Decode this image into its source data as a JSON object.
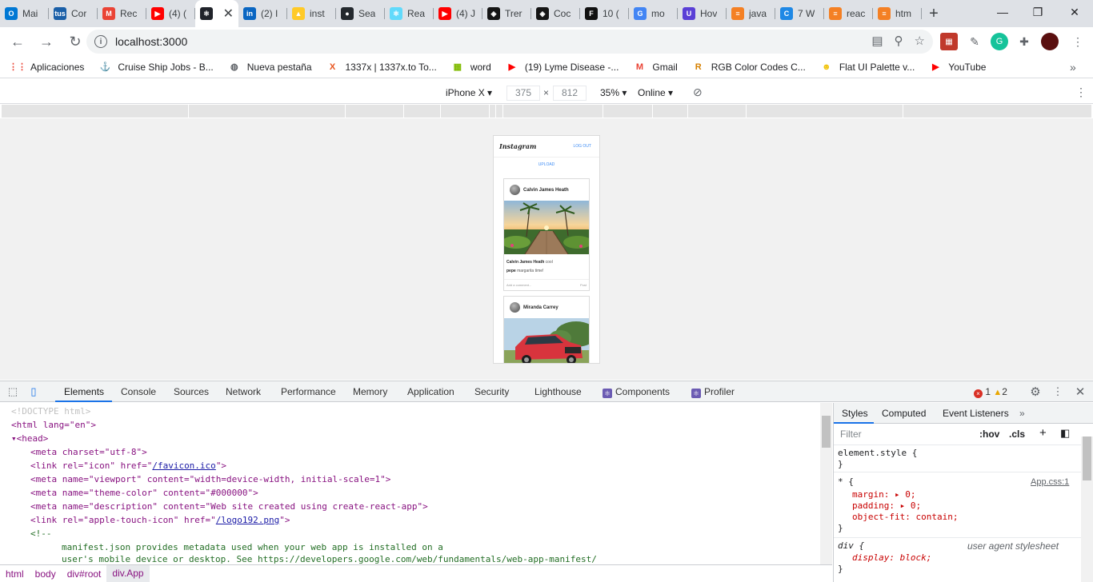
{
  "browser": {
    "tabs": [
      {
        "label": "Mai",
        "icon": "outlook-icon",
        "color": "#0078d4",
        "glyph": "O"
      },
      {
        "label": "Cor",
        "icon": "tus-icon",
        "color": "#1a5fa8",
        "glyph": "tus"
      },
      {
        "label": "Rec",
        "icon": "gmail-icon",
        "color": "#ea4335",
        "glyph": "M"
      },
      {
        "label": "(4) (",
        "icon": "youtube-icon",
        "color": "#ff0000",
        "glyph": "▶"
      },
      {
        "label": "",
        "icon": "react-icon",
        "color": "#20232a",
        "glyph": "⚛",
        "active": true
      },
      {
        "label": "(2) I",
        "icon": "linkedin-icon",
        "color": "#0a66c2",
        "glyph": "in"
      },
      {
        "label": "inst",
        "icon": "firebase-icon",
        "color": "#ffca28",
        "glyph": "▲"
      },
      {
        "label": "Sea",
        "icon": "github-icon",
        "color": "#24292e",
        "glyph": "●"
      },
      {
        "label": "Rea",
        "icon": "react-icon",
        "color": "#61dafb",
        "glyph": "⚛"
      },
      {
        "label": "(4) J",
        "icon": "youtube-icon",
        "color": "#ff0000",
        "glyph": "▶"
      },
      {
        "label": "Trer",
        "icon": "codesandbox-icon",
        "color": "#151515",
        "glyph": "◈"
      },
      {
        "label": "Coc",
        "icon": "codesandbox-icon",
        "color": "#151515",
        "glyph": "◈"
      },
      {
        "label": "10 (",
        "icon": "f-icon",
        "color": "#111111",
        "glyph": "F"
      },
      {
        "label": "mo",
        "icon": "google-icon",
        "color": "#4285f4",
        "glyph": "G"
      },
      {
        "label": "Hov",
        "icon": "u-icon",
        "color": "#5a3fd6",
        "glyph": "U"
      },
      {
        "label": "java",
        "icon": "stackoverflow-icon",
        "color": "#f48024",
        "glyph": "≡"
      },
      {
        "label": "7 W",
        "icon": "c-icon",
        "color": "#1e88e5",
        "glyph": "C"
      },
      {
        "label": "reac",
        "icon": "stackoverflow-icon",
        "color": "#f48024",
        "glyph": "≡"
      },
      {
        "label": "htm",
        "icon": "stackoverflow-icon",
        "color": "#f48024",
        "glyph": "≡"
      }
    ],
    "url": "localhost:3000",
    "bookmarks": [
      {
        "label": "Aplicaciones",
        "icon": "apps-grid-icon",
        "glyph": "⋮⋮",
        "color": "#ea4335"
      },
      {
        "label": "Cruise Ship Jobs - B...",
        "icon": "anchor-icon",
        "glyph": "⚓",
        "color": "#f5a623"
      },
      {
        "label": "Nueva pestaña",
        "icon": "globe-icon",
        "glyph": "◍",
        "color": "#5f6368"
      },
      {
        "label": "1337x | 1337x.to To...",
        "icon": "x-icon",
        "glyph": "X",
        "color": "#e8541e"
      },
      {
        "label": "word",
        "icon": "microsoft-icon",
        "glyph": "▦",
        "color": "#7fba00"
      },
      {
        "label": "(19) Lyme Disease -...",
        "icon": "youtube-icon",
        "glyph": "▶",
        "color": "#ff0000"
      },
      {
        "label": "Gmail",
        "icon": "gmail-icon",
        "glyph": "M",
        "color": "#ea4335"
      },
      {
        "label": "RGB Color Codes C...",
        "icon": "r-icon",
        "glyph": "R",
        "color": "#d68000"
      },
      {
        "label": "Flat UI Palette v...",
        "icon": "emoji-icon",
        "glyph": "☻",
        "color": "#f1c40f"
      },
      {
        "label": "YouTube",
        "icon": "youtube-icon",
        "glyph": "▶",
        "color": "#ff0000"
      }
    ]
  },
  "device_toolbar": {
    "device": "iPhone X",
    "width": "375",
    "height": "812",
    "zoom": "35%",
    "throttle": "Online"
  },
  "instagram": {
    "logo": "Instagram",
    "logout": "LOG OUT",
    "upload": "UPLOAD",
    "posts": [
      {
        "username": "Calvin James Heath",
        "caption_user": "Calvin James Heath",
        "caption": "cool",
        "comments": [
          {
            "user": "pepe",
            "text": "margarita time!"
          }
        ],
        "add_comment_placeholder": "Add a comment...",
        "post_button": "Post"
      },
      {
        "username": "Miranda Carrey"
      }
    ]
  },
  "devtools": {
    "tabs": [
      "Elements",
      "Console",
      "Sources",
      "Network",
      "Performance",
      "Memory",
      "Application",
      "Security",
      "Lighthouse",
      "Components",
      "Profiler"
    ],
    "error_count": "1",
    "warning_count": "2",
    "breadcrumb": [
      "html",
      "body",
      "div#root",
      "div.App"
    ],
    "styles_tabs": [
      "Styles",
      "Computed",
      "Event Listeners"
    ],
    "filter_placeholder": "Filter",
    "hov": ":hov",
    "cls": ".cls",
    "element_style": "element.style {",
    "rule1_selector": "* {",
    "rule1_source": "App.css:1",
    "rule1_props": [
      "margin: ▸ 0;",
      "padding: ▸ 0;",
      "object-fit: contain;"
    ],
    "rule2_selector": "div {",
    "rule2_source": "user agent stylesheet",
    "rule2_props": [
      "display: block;"
    ],
    "close_brace": "}",
    "html_lines": {
      "doctype": "<!DOCTYPE html>",
      "html_open": "<html lang=\"en\">",
      "head_open": "<head>",
      "meta_charset": "<meta charset=\"utf-8\">",
      "link_icon_pre": "<link rel=\"icon\" href=\"",
      "link_icon_href": "/favicon.ico",
      "link_icon_post": "\">",
      "meta_viewport": "<meta name=\"viewport\" content=\"width=device-width, initial-scale=1\">",
      "meta_theme": "<meta name=\"theme-color\" content=\"#000000\">",
      "meta_description": "<meta name=\"description\" content=\"Web site created using create-react-app\">",
      "link_apple_pre": "<link rel=\"apple-touch-icon\" href=\"",
      "link_apple_href": "/logo192.png",
      "link_apple_post": "\">",
      "comment_open": "<!--",
      "comment_line1": "manifest.json provides metadata used when your web app is installed on a",
      "comment_line2": "user's mobile device or desktop. See https://developers.google.com/web/fundamentals/web-app-manifest/"
    }
  }
}
